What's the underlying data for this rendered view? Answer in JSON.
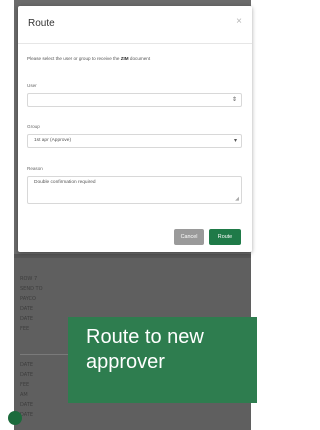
{
  "modal": {
    "title": "Route",
    "close": "×",
    "instruction_pre": "Please select the user or group to receive the ",
    "instruction_bold": "ZIM",
    "instruction_post": " document",
    "user_label": "User",
    "user_value": "",
    "group_label": "Group",
    "group_value": "1st apr (Approve)",
    "reason_label": "Reason",
    "reason_value": "Double confirmation required",
    "cancel_label": "Cancel",
    "route_label": "Route"
  },
  "background": {
    "rows": [
      "ROW 7",
      "SEND TO",
      "PAYCO",
      "DATE",
      "DATE",
      "FEE",
      "DATE",
      "DATE",
      "FEE",
      "AM",
      "DATE",
      "DATE"
    ]
  },
  "caption": {
    "text": "Route to new\napprover"
  },
  "colors": {
    "accent": "#1f7a48",
    "caption_bg": "#2e7d4f",
    "cancel": "#9a9a9a",
    "overlay": "#6b6b6b"
  }
}
